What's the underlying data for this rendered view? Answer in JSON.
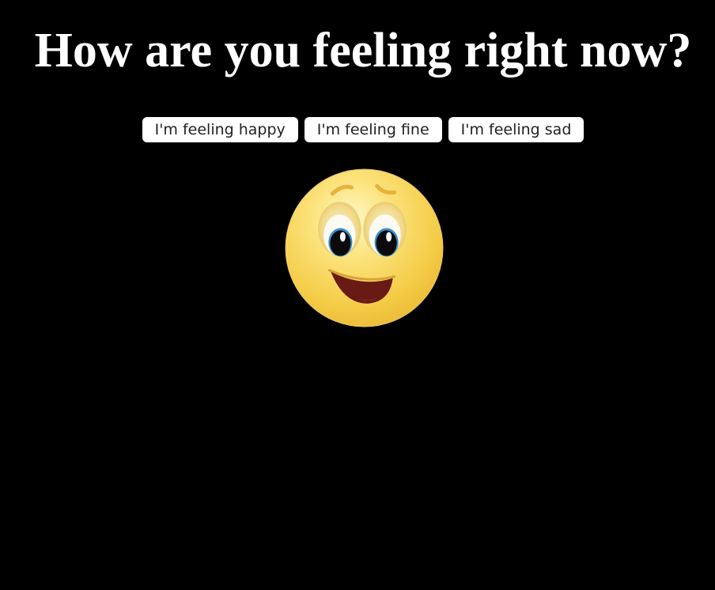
{
  "page": {
    "title": "How are you feeling right now?",
    "background_color": "#000000"
  },
  "buttons": [
    {
      "label": "I'm feeling happy"
    },
    {
      "label": "I'm feeling fine"
    },
    {
      "label": "I'm feeling sad"
    }
  ],
  "mood_image": {
    "icon": "happy-face-emoji-icon",
    "face_color": "#f6d24a",
    "mouth_color": "#6a1a14"
  }
}
